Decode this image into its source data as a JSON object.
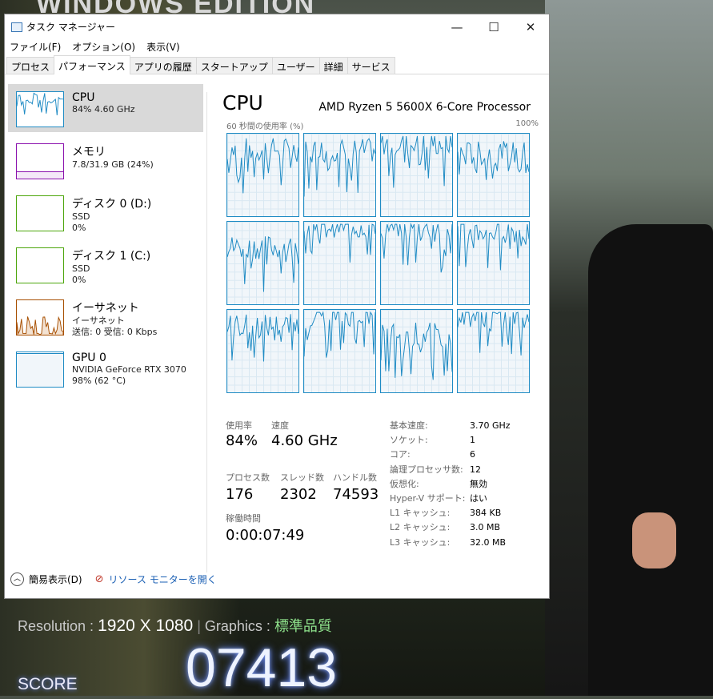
{
  "background": {
    "banner": "WINDOWS EDITION",
    "resolution_label": "Resolution :",
    "resolution": "1920 X 1080",
    "graphics_label": "Graphics :",
    "graphics": "標準品質",
    "score": "07413",
    "score_label": "SCORE"
  },
  "window": {
    "title": "タスク マネージャー",
    "minimize": "—",
    "maximize": "☐",
    "close": "✕"
  },
  "menu": [
    "ファイル(F)",
    "オプション(O)",
    "表示(V)"
  ],
  "tabs": [
    "プロセス",
    "パフォーマンス",
    "アプリの履歴",
    "スタートアップ",
    "ユーザー",
    "詳細",
    "サービス"
  ],
  "sidebar": [
    {
      "title": "CPU",
      "l1": "84%  4.60 GHz",
      "l2": ""
    },
    {
      "title": "メモリ",
      "l1": "7.8/31.9 GB (24%)",
      "l2": ""
    },
    {
      "title": "ディスク 0 (D:)",
      "l1": "SSD",
      "l2": "0%"
    },
    {
      "title": "ディスク 1 (C:)",
      "l1": "SSD",
      "l2": "0%"
    },
    {
      "title": "イーサネット",
      "l1": "イーサネット",
      "l2": "送信: 0 受信: 0 Kbps"
    },
    {
      "title": "GPU 0",
      "l1": "NVIDIA GeForce RTX 3070",
      "l2": "98% (62 °C)"
    }
  ],
  "main": {
    "title": "CPU",
    "processor": "AMD Ryzen 5 5600X 6-Core Processor",
    "graph_label": "60 秒間の使用率 (%)",
    "graph_max": "100%",
    "cores": 12,
    "memory_percent": 24,
    "gpu_percent": 98
  },
  "stats": {
    "usage_label": "使用率",
    "usage": "84%",
    "speed_label": "速度",
    "speed": "4.60 GHz",
    "proc_label": "プロセス数",
    "proc": "176",
    "thread_label": "スレッド数",
    "thread": "2302",
    "handle_label": "ハンドル数",
    "handle": "74593",
    "uptime_label": "稼働時間",
    "uptime": "0:00:07:49"
  },
  "specs": [
    [
      "基本速度:",
      "3.70 GHz"
    ],
    [
      "ソケット:",
      "1"
    ],
    [
      "コア:",
      "6"
    ],
    [
      "論理プロセッサ数:",
      "12"
    ],
    [
      "仮想化:",
      "無効"
    ],
    [
      "Hyper-V サポート:",
      "はい"
    ],
    [
      "L1 キャッシュ:",
      "384 KB"
    ],
    [
      "L2 キャッシュ:",
      "3.0 MB"
    ],
    [
      "L3 キャッシュ:",
      "32.0 MB"
    ]
  ],
  "footer": {
    "fewer": "簡易表示(D)",
    "monitor": "リソース モニターを開く"
  },
  "colors": {
    "cpu": "#1f8bc4",
    "memory": "#8b12ae",
    "disk": "#4da60c",
    "net": "#a74f01"
  }
}
